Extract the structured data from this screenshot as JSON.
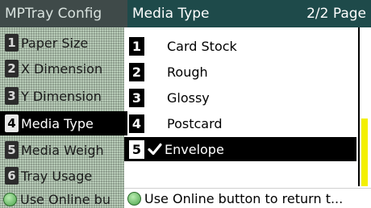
{
  "config_panel": {
    "title": "MPTray Config",
    "items": [
      {
        "number": "1",
        "label": "Paper Size"
      },
      {
        "number": "2",
        "label": "X Dimension"
      },
      {
        "number": "3",
        "label": "Y Dimension"
      },
      {
        "number": "4",
        "label": "Media Type"
      },
      {
        "number": "5",
        "label": "Media Weigh"
      },
      {
        "number": "6",
        "label": "Tray Usage"
      }
    ],
    "footer": "Use Online bu"
  },
  "media_panel": {
    "title": "Media Type",
    "page": "2/2 Page",
    "items": [
      {
        "number": "1",
        "label": "Card Stock"
      },
      {
        "number": "2",
        "label": "Rough"
      },
      {
        "number": "3",
        "label": "Glossy"
      },
      {
        "number": "4",
        "label": "Postcard"
      },
      {
        "number": "5",
        "label": "Envelope"
      }
    ],
    "footer": "Use Online button to return t..."
  },
  "scroll_position_fraction": 0.57,
  "colors": {
    "title_bar": "#1e4a4a",
    "selected_row": "#000000",
    "scroll_thumb": "#f3f000",
    "button_indicator": "#4aa24a"
  }
}
